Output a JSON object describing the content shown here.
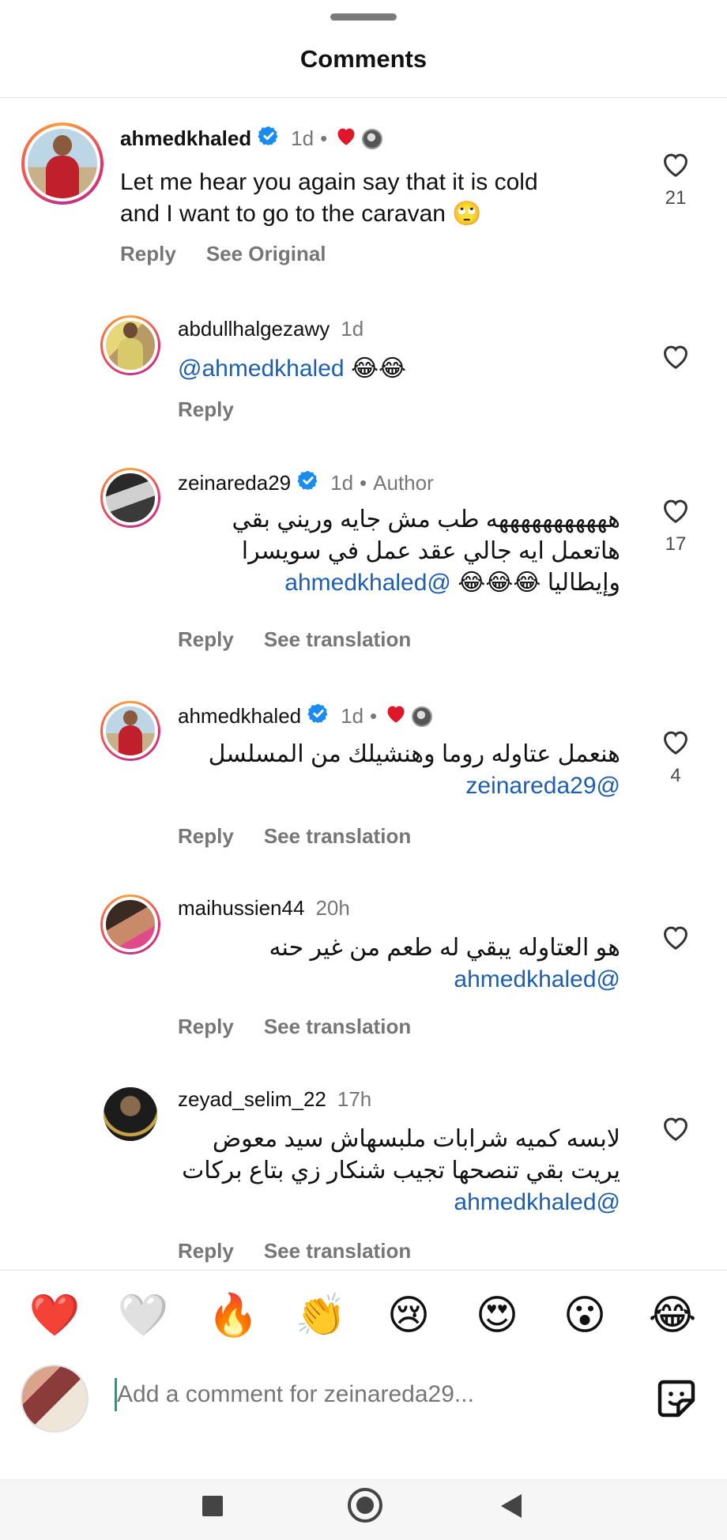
{
  "header": {
    "title": "Comments"
  },
  "comments": [
    {
      "username": "ahmedkhaled",
      "time": "1d",
      "separator": "•",
      "text": "Let me hear you again say that it is cold and I want to go to the caravan 🙄",
      "likes": "21",
      "reply_label": "Reply",
      "secondary_label": "See Original"
    },
    {
      "username": "abdullhalgezawy",
      "time": "1d",
      "mention": "@ahmedkhaled",
      "text": "😂😂",
      "reply_label": "Reply"
    },
    {
      "username": "zeinareda29",
      "time": "1d",
      "separator": "•",
      "badge": "Author",
      "mention": "@ahmedkhaled",
      "text": "هههههههههههه طب مش جايه وريني بقي هاتعمل ايه جالي عقد عمل في سويسرا وإيطاليا 😂😂😂",
      "likes": "17",
      "reply_label": "Reply",
      "secondary_label": "See translation"
    },
    {
      "username": "ahmedkhaled",
      "time": "1d",
      "separator": "•",
      "mention": "@zeinareda29",
      "text": "هنعمل عتاوله روما وهنشيلك من المسلسل",
      "likes": "4",
      "reply_label": "Reply",
      "secondary_label": "See translation"
    },
    {
      "username": "maihussien44",
      "time": "20h",
      "mention": "@ahmedkhaled",
      "text": "هو العتاوله يبقي له طعم من غير حنه",
      "reply_label": "Reply",
      "secondary_label": "See translation"
    },
    {
      "username": "zeyad_selim_22",
      "time": "17h",
      "mention": "@ahmedkhaled",
      "text": "لابسه كميه شرابات ملبسهاش سيد معوض يريت بقي تنصحها تجيب شنكار زي بتاع بركات",
      "reply_label": "Reply",
      "secondary_label": "See translation"
    }
  ],
  "reactions": [
    "❤️",
    "🤍",
    "🔥",
    "👏",
    "😢",
    "😍",
    "😮",
    "😂"
  ],
  "input": {
    "placeholder": "Add a comment for zeinareda29..."
  },
  "icons": {
    "verified": "verified-badge-icon",
    "like": "heart-outline-icon",
    "sticker": "sticker-icon",
    "nav": [
      "recents-square-icon",
      "home-circle-icon",
      "back-triangle-icon"
    ]
  },
  "colors": {
    "mention": "#1d5fae",
    "verified": "#1a8cf0",
    "heart_red": "#e0162b",
    "muted_text": "#767676"
  }
}
